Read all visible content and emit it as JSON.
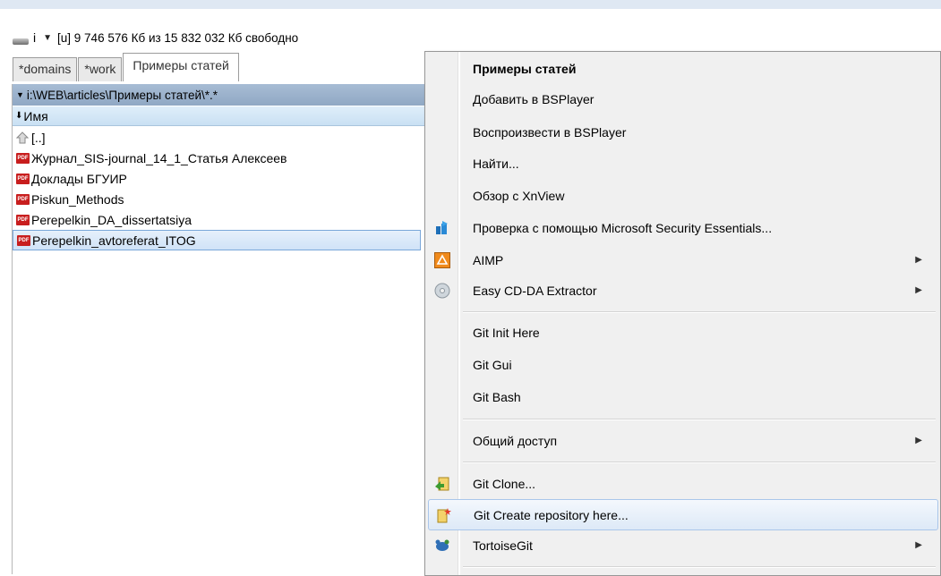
{
  "drive": {
    "letter": "i",
    "info": "[u] 9 746 576 Кб из 15 832 032 Кб свободно"
  },
  "tabs": [
    {
      "label": "*domains"
    },
    {
      "label": "*work"
    },
    {
      "label": "Примеры статей"
    }
  ],
  "panel": {
    "path": "i:\\WEB\\articles\\Примеры статей\\*.*",
    "column_header": "Имя",
    "files": [
      {
        "name": "[..]",
        "type": "up"
      },
      {
        "name": "Журнал_SIS-journal_14_1_Статья Алексеев",
        "type": "pdf"
      },
      {
        "name": "Доклады БГУИР",
        "type": "pdf"
      },
      {
        "name": "Piskun_Methods",
        "type": "pdf"
      },
      {
        "name": "Perepelkin_DA_dissertatsiya",
        "type": "pdf"
      },
      {
        "name": "Perepelkin_avtoreferat_ITOG",
        "type": "pdf"
      }
    ]
  },
  "menu": {
    "items": [
      {
        "label": "Примеры статей"
      },
      {
        "label": "Добавить в BSPlayer"
      },
      {
        "label": "Воспроизвести в BSPlayer"
      },
      {
        "label": "Найти..."
      },
      {
        "label": "Обзор с XnView"
      },
      {
        "label": "Проверка с помощью Microsoft Security Essentials..."
      },
      {
        "label": "AIMP"
      },
      {
        "label": "Easy CD-DA Extractor"
      },
      {
        "label": "Git Init Here"
      },
      {
        "label": "Git Gui"
      },
      {
        "label": "Git Bash"
      },
      {
        "label": "Общий доступ"
      },
      {
        "label": "Git Clone..."
      },
      {
        "label": "Git Create repository here..."
      },
      {
        "label": "TortoiseGit"
      }
    ]
  },
  "colors": {
    "path_bar": "#9fb5cf",
    "header": "#d4e6f6",
    "pdf": "#c81e1e",
    "selection": "#cfe2f7"
  }
}
